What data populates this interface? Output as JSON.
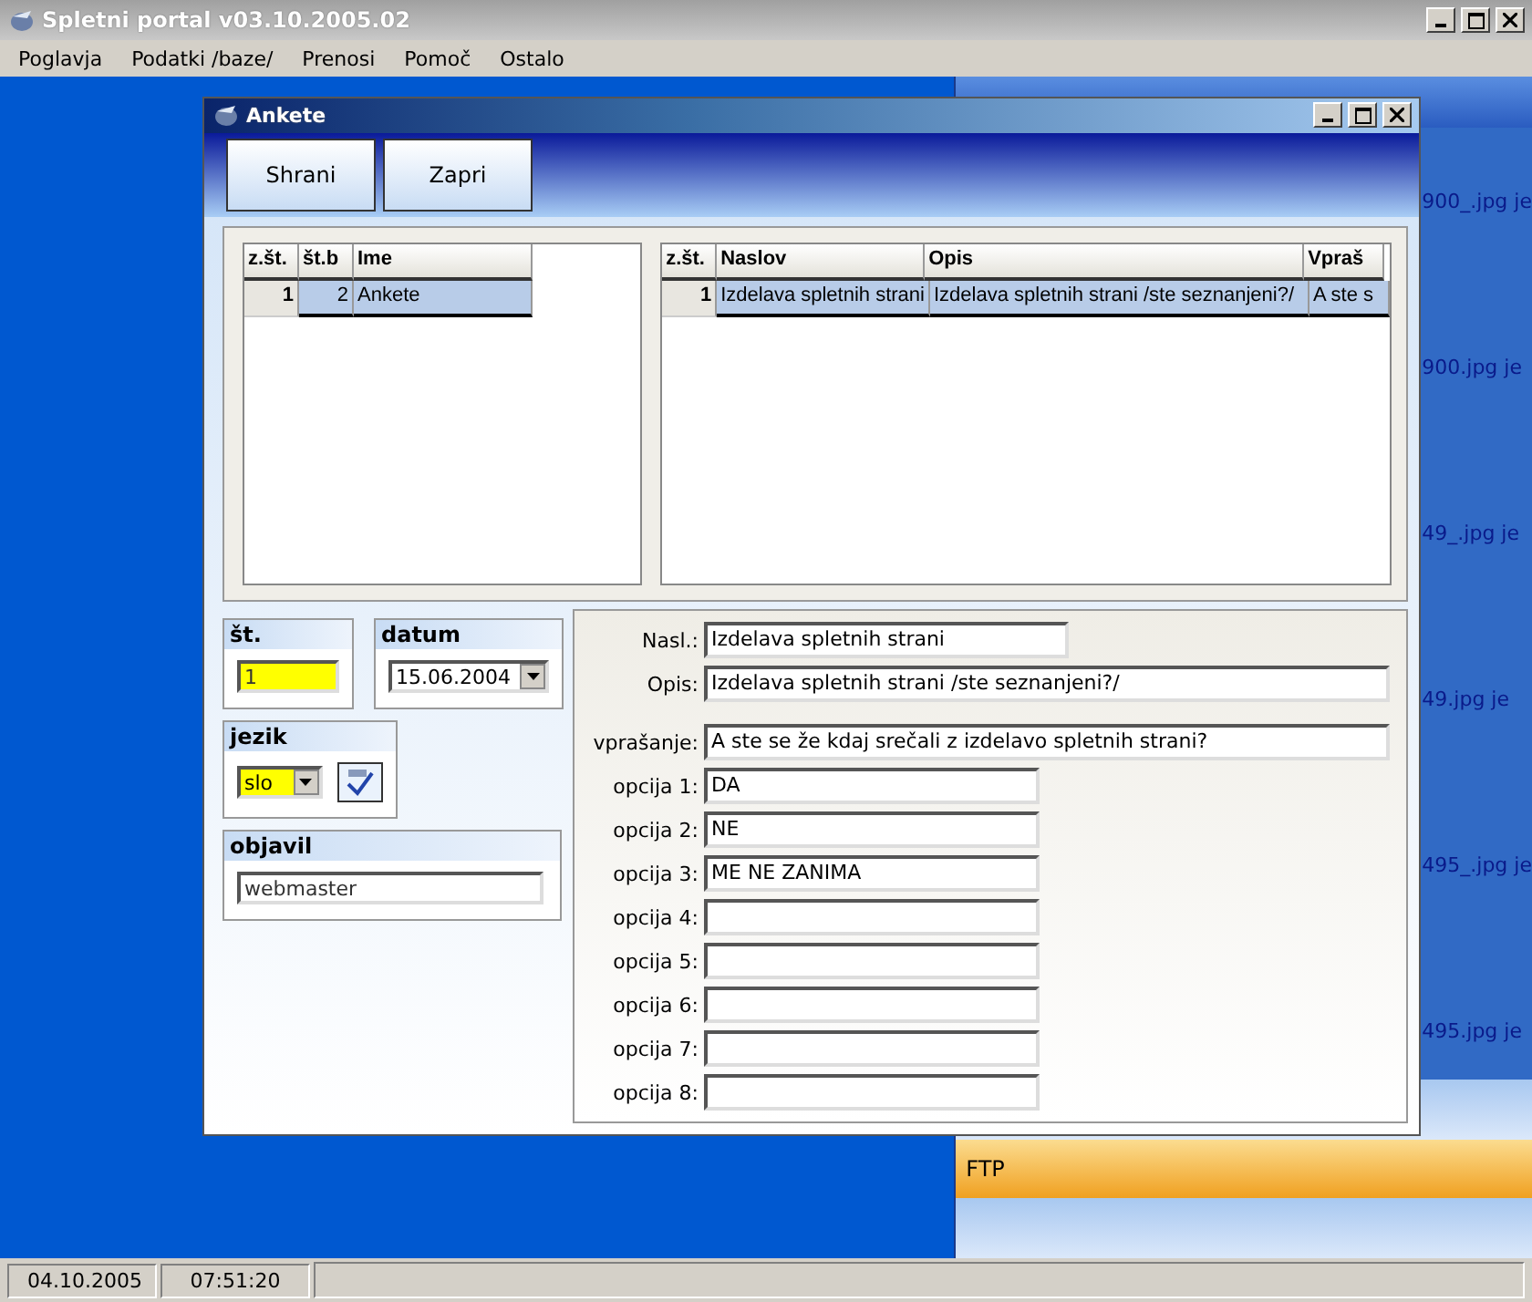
{
  "window": {
    "title": "Spletni portal v03.10.2005.02"
  },
  "menu": [
    {
      "label": "Poglavja"
    },
    {
      "label": "Podatki /baze/"
    },
    {
      "label": "Prenosi"
    },
    {
      "label": "Pomoč"
    },
    {
      "label": "Ostalo"
    }
  ],
  "background_panel": {
    "items": [
      "900_.jpg je",
      "900.jpg je",
      "49_.jpg je",
      "49.jpg je",
      "495_.jpg je",
      "495.jpg je"
    ],
    "ftp_label": "FTP"
  },
  "child_window": {
    "title": "Ankete",
    "buttons": [
      "Shrani",
      "Zapri"
    ],
    "left_grid": {
      "columns": [
        "z.št.",
        "št.b",
        "Ime"
      ],
      "rows": [
        {
          "cells": [
            "1",
            "2",
            "Ankete"
          ],
          "selected": true
        }
      ]
    },
    "right_grid": {
      "columns": [
        "z.št.",
        "Naslov",
        "Opis",
        "Vpraš"
      ],
      "rows": [
        {
          "cells": [
            "1",
            "Izdelava spletnih strani",
            "Izdelava spletnih strani /ste seznanjeni?/",
            "A ste s"
          ],
          "selected": true
        }
      ]
    },
    "st": {
      "label": "št.",
      "value": "1"
    },
    "datum": {
      "label": "datum",
      "value": "15.06.2004"
    },
    "jezik": {
      "label": "jezik",
      "value": "slo"
    },
    "objavil": {
      "label": "objavil",
      "value": "webmaster"
    },
    "form": [
      {
        "label": "Nasl.:",
        "value": "Izdelava spletnih strani",
        "kind": "medium"
      },
      {
        "label": "Opis:",
        "value": "Izdelava spletnih strani /ste seznanjeni?/",
        "kind": "wide"
      },
      {
        "label": "vprašanje:",
        "value": "A ste se že kdaj srečali z izdelavo spletnih strani?",
        "kind": "wide"
      },
      {
        "label": "opcija 1:",
        "value": "DA",
        "kind": "short"
      },
      {
        "label": "opcija 2:",
        "value": "NE",
        "kind": "short"
      },
      {
        "label": "opcija 3:",
        "value": "ME NE ZANIMA",
        "kind": "short"
      },
      {
        "label": "opcija 4:",
        "kind": "short"
      },
      {
        "label": "opcija 5:",
        "kind": "short"
      },
      {
        "label": "opcija 6:",
        "kind": "short"
      },
      {
        "label": "opcija 7:",
        "kind": "short"
      },
      {
        "label": "opcija 8:",
        "kind": "short"
      }
    ]
  },
  "status_bar": [
    "04.10.2005",
    "07:51:20"
  ]
}
